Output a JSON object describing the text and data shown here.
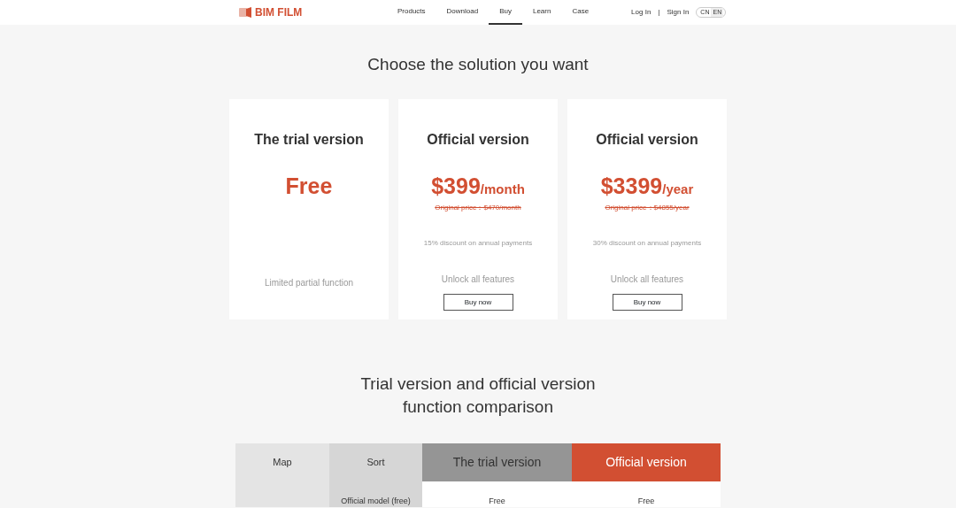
{
  "header": {
    "logo_text": "BIM FILM",
    "nav": [
      {
        "label": "Products",
        "selected": false
      },
      {
        "label": "Download",
        "selected": false
      },
      {
        "label": "Buy",
        "selected": true
      },
      {
        "label": "Learn",
        "selected": false
      },
      {
        "label": "Case",
        "selected": false
      }
    ],
    "login": "Log In",
    "separator": "|",
    "signin": "Sign In",
    "languages": [
      {
        "label": "CN",
        "selected": false
      },
      {
        "label": "EN",
        "selected": true
      }
    ]
  },
  "title": "Choose the solution you want",
  "plans": [
    {
      "name": "The trial version",
      "price": "Free",
      "feature": "Limited partial function"
    },
    {
      "name": "Official version",
      "price": "$399",
      "period": "/month",
      "original": "Original price：$470/month",
      "discount": "15% discount on annual payments",
      "feature": "Unlock all features",
      "button": "Buy now"
    },
    {
      "name": "Official version",
      "price": "$3399",
      "period": "/year",
      "original": "Original price：$4855/year",
      "discount": "30% discount on annual payments",
      "feature": "Unlock all features",
      "button": "Buy now"
    }
  ],
  "comparison": {
    "title": "Trial version and official version function comparison",
    "columns": [
      {
        "label": "Map",
        "kind": "light"
      },
      {
        "label": "Sort",
        "kind": "mid"
      },
      {
        "label": "The trial version",
        "kind": "dark"
      },
      {
        "label": "Official version",
        "kind": "accent"
      }
    ],
    "rows": [
      [
        "",
        "Official model (free)",
        "Free",
        "Free"
      ]
    ]
  }
}
